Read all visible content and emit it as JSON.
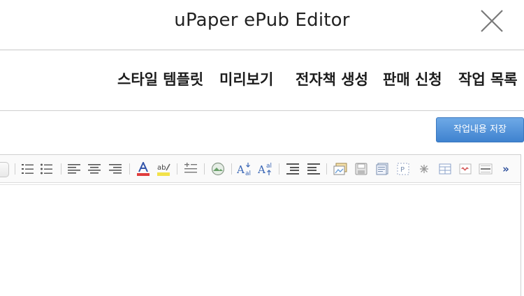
{
  "window": {
    "title": "uPaper ePub Editor"
  },
  "menu": {
    "items": [
      {
        "label": "스타일 템플릿"
      },
      {
        "label": "미리보기"
      },
      {
        "label": "전자책 생성"
      },
      {
        "label": "판매 신청"
      },
      {
        "label": "작업 목록"
      }
    ]
  },
  "actions": {
    "save_label": "작업내용 저장"
  },
  "colors": {
    "accent": "#4a8dd8",
    "font_color_bar": "#e03c3c",
    "highlight_bar": "#f2e24a"
  },
  "toolbar": {
    "icons": [
      "style-dropdown-icon",
      "ordered-list-icon",
      "unordered-list-icon",
      "align-left-icon",
      "align-center-icon",
      "align-right-icon",
      "font-color-icon",
      "highlight-color-icon",
      "line-height-icon",
      "image-icon",
      "font-size-decrease-icon",
      "font-size-increase-icon",
      "indent-icon",
      "outdent-icon",
      "insert-image-icon",
      "save-icon",
      "document-icon",
      "page-break-icon",
      "special-char-icon",
      "table-icon",
      "link-icon",
      "horizontal-rule-icon",
      "more-icon"
    ],
    "more_label": "»"
  }
}
